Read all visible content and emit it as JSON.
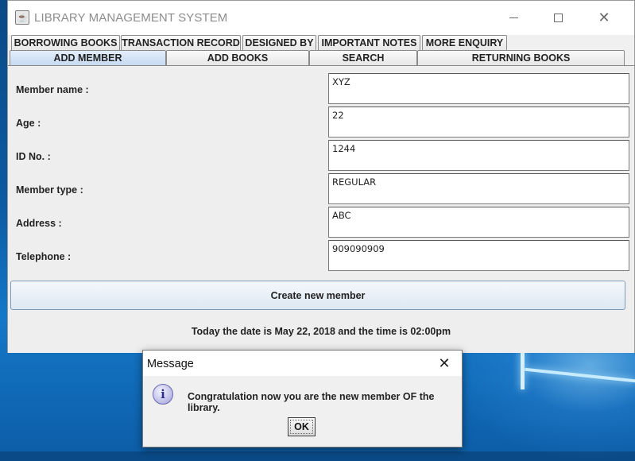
{
  "window": {
    "title": "LIBRARY MANAGEMENT SYSTEM",
    "app_icon": "java-coffee-icon",
    "controls": {
      "minimize": "minimize-icon",
      "maximize": "maximize-icon",
      "close": "✕"
    }
  },
  "tabs": {
    "row1": [
      "BORROWING BOOKS",
      "TRANSACTION RECORD",
      "DESIGNED BY",
      "IMPORTANT NOTES",
      "MORE ENQUIRY"
    ],
    "row2": [
      "ADD MEMBER",
      "ADD BOOKS",
      "SEARCH",
      "RETURNING BOOKS"
    ],
    "active": "ADD MEMBER"
  },
  "form": {
    "fields": [
      {
        "label": "Member name  :",
        "value": "XYZ"
      },
      {
        "label": "Age  :",
        "value": "22"
      },
      {
        "label": "ID No. :",
        "value": "1244"
      },
      {
        "label": "Member type  :",
        "value": "REGULAR"
      },
      {
        "label": "Address  :",
        "value": "ABC"
      },
      {
        "label": "Telephone  :",
        "value": "909090909"
      }
    ],
    "create_button": "Create new member",
    "date_text": "Today the date is May 22, 2018 and the time is 02:00pm"
  },
  "dialog": {
    "title": "Message",
    "close": "✕",
    "icon": "info-icon",
    "message": "Congratulation now you are the new member OF the library.",
    "ok_label": "OK"
  },
  "colors": {
    "active_tab": "#c7daf1",
    "button_border": "#7d99b8",
    "desktop": "#0c5aa2"
  }
}
